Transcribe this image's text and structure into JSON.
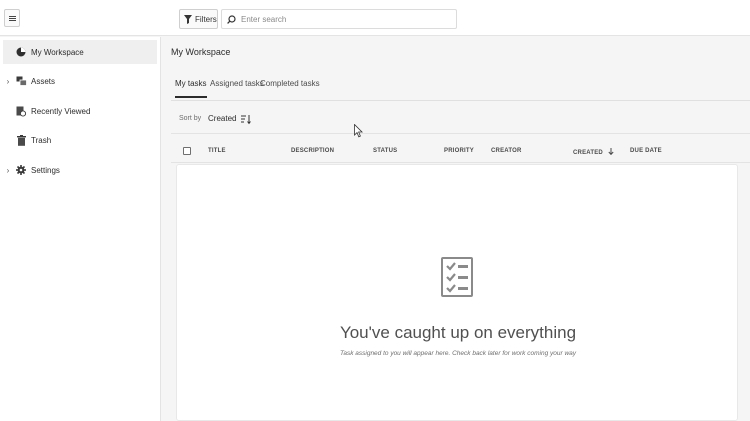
{
  "header": {
    "menu_icon": "hamburger-icon",
    "filters_label": "Filters",
    "filters_icon": "funnel-icon",
    "search_icon": "search-icon",
    "search_placeholder": "Enter search"
  },
  "sidebar": {
    "items": [
      {
        "label": "My Workspace",
        "icon": "workspace-icon",
        "expandable": false,
        "active": true
      },
      {
        "label": "Assets",
        "icon": "assets-icon",
        "expandable": true,
        "active": false
      },
      {
        "label": "Recently Viewed",
        "icon": "recent-icon",
        "expandable": false,
        "active": false
      },
      {
        "label": "Trash",
        "icon": "trash-icon",
        "expandable": false,
        "active": false
      },
      {
        "label": "Settings",
        "icon": "gear-icon",
        "expandable": true,
        "active": false
      }
    ]
  },
  "main": {
    "title": "My Workspace",
    "tabs": [
      {
        "label": "My tasks",
        "active": true
      },
      {
        "label": "Assigned tasks",
        "active": false
      },
      {
        "label": "Completed tasks",
        "active": false
      }
    ],
    "sort": {
      "label": "Sort by",
      "value": "Created",
      "direction_icon": "sort-direction-icon"
    },
    "columns": [
      "TITLE",
      "DESCRIPTION",
      "STATUS",
      "PRIORITY",
      "CREATOR",
      "CREATED",
      "DUE DATE"
    ],
    "sorted_column_icon": "arrow-down-icon",
    "empty_state": {
      "icon": "checklist-icon",
      "title": "You've caught up on everything",
      "subtitle": "Task assigned to you will appear here. Check back later for work coming your way"
    }
  },
  "colors": {
    "background": "#f5f5f5",
    "panel": "#ffffff",
    "text": "#2c2c2c",
    "muted": "#6e6e6e",
    "icon_gray": "#8a8a8a"
  }
}
